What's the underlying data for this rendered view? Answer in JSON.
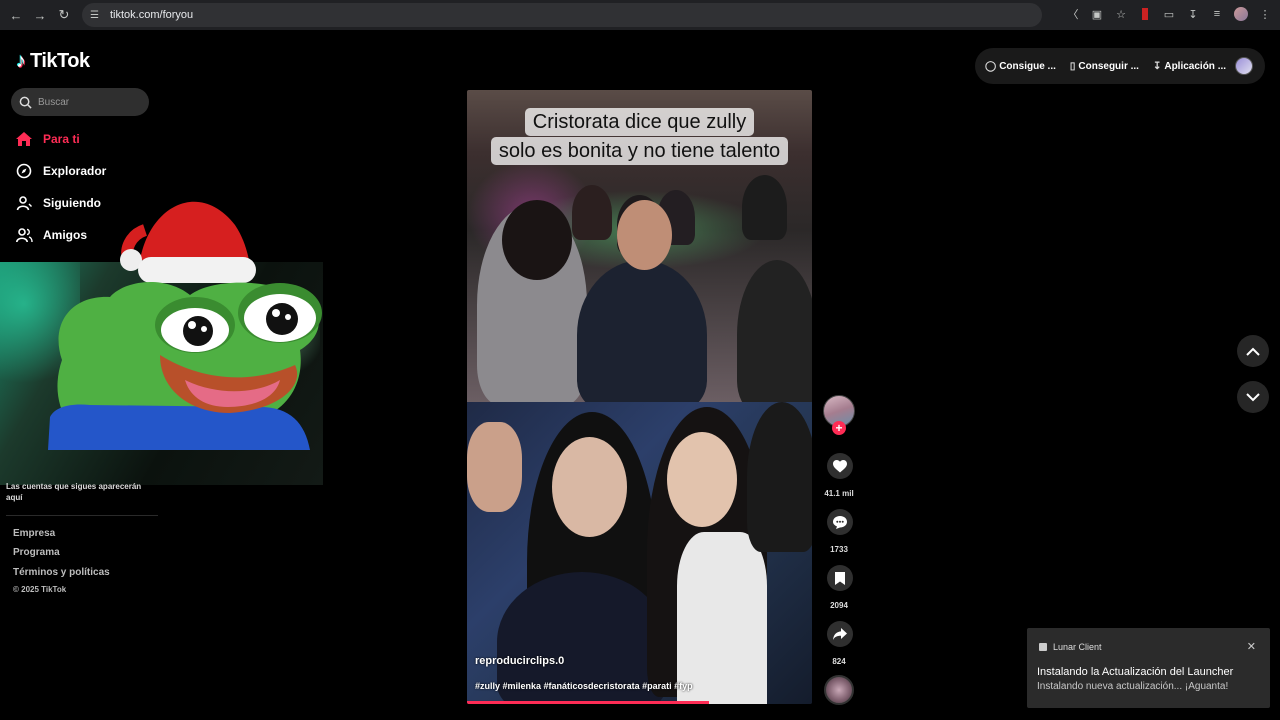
{
  "browser": {
    "url": "tiktok.com/foryou"
  },
  "app": {
    "logo_text": "TikTok"
  },
  "search": {
    "placeholder": "Buscar"
  },
  "sidebar": {
    "items": [
      {
        "label": "Para ti",
        "icon": "home-icon",
        "active": true
      },
      {
        "label": "Explorador",
        "icon": "compass-icon"
      },
      {
        "label": "Siguiendo",
        "icon": "user-follow-icon"
      },
      {
        "label": "Amigos",
        "icon": "friends-icon"
      }
    ],
    "following_note": "Las cuentas que sigues aparecerán aquí",
    "footer": [
      "Empresa",
      "Programa",
      "Términos y políticas"
    ],
    "copyright": "© 2025 TikTok"
  },
  "topbar": {
    "buttons": [
      {
        "label": "Consigue ...",
        "icon": "coin-icon"
      },
      {
        "label": "Conseguir ...",
        "icon": "phone-icon"
      },
      {
        "label": "Aplicación ...",
        "icon": "download-icon"
      }
    ]
  },
  "video": {
    "caption_line1": "Cristorata dice que zully",
    "caption_line2": "solo es bonita y no tiene talento",
    "author": "reproducirclips.0",
    "hashtags": "#zully #milenka #fanáticosdecristorata #parati #fyp",
    "progress": 0.7
  },
  "actions": {
    "likes": "41.1 mil",
    "comments": "1733",
    "saves": "2094",
    "shares": "824"
  },
  "toast": {
    "app_name": "Lunar Client",
    "title": "Instalando la Actualización del Launcher",
    "body": "Instalando nueva actualización... ¡Aguanta!"
  },
  "colors": {
    "accent": "#fe2c55",
    "background": "#000000"
  }
}
